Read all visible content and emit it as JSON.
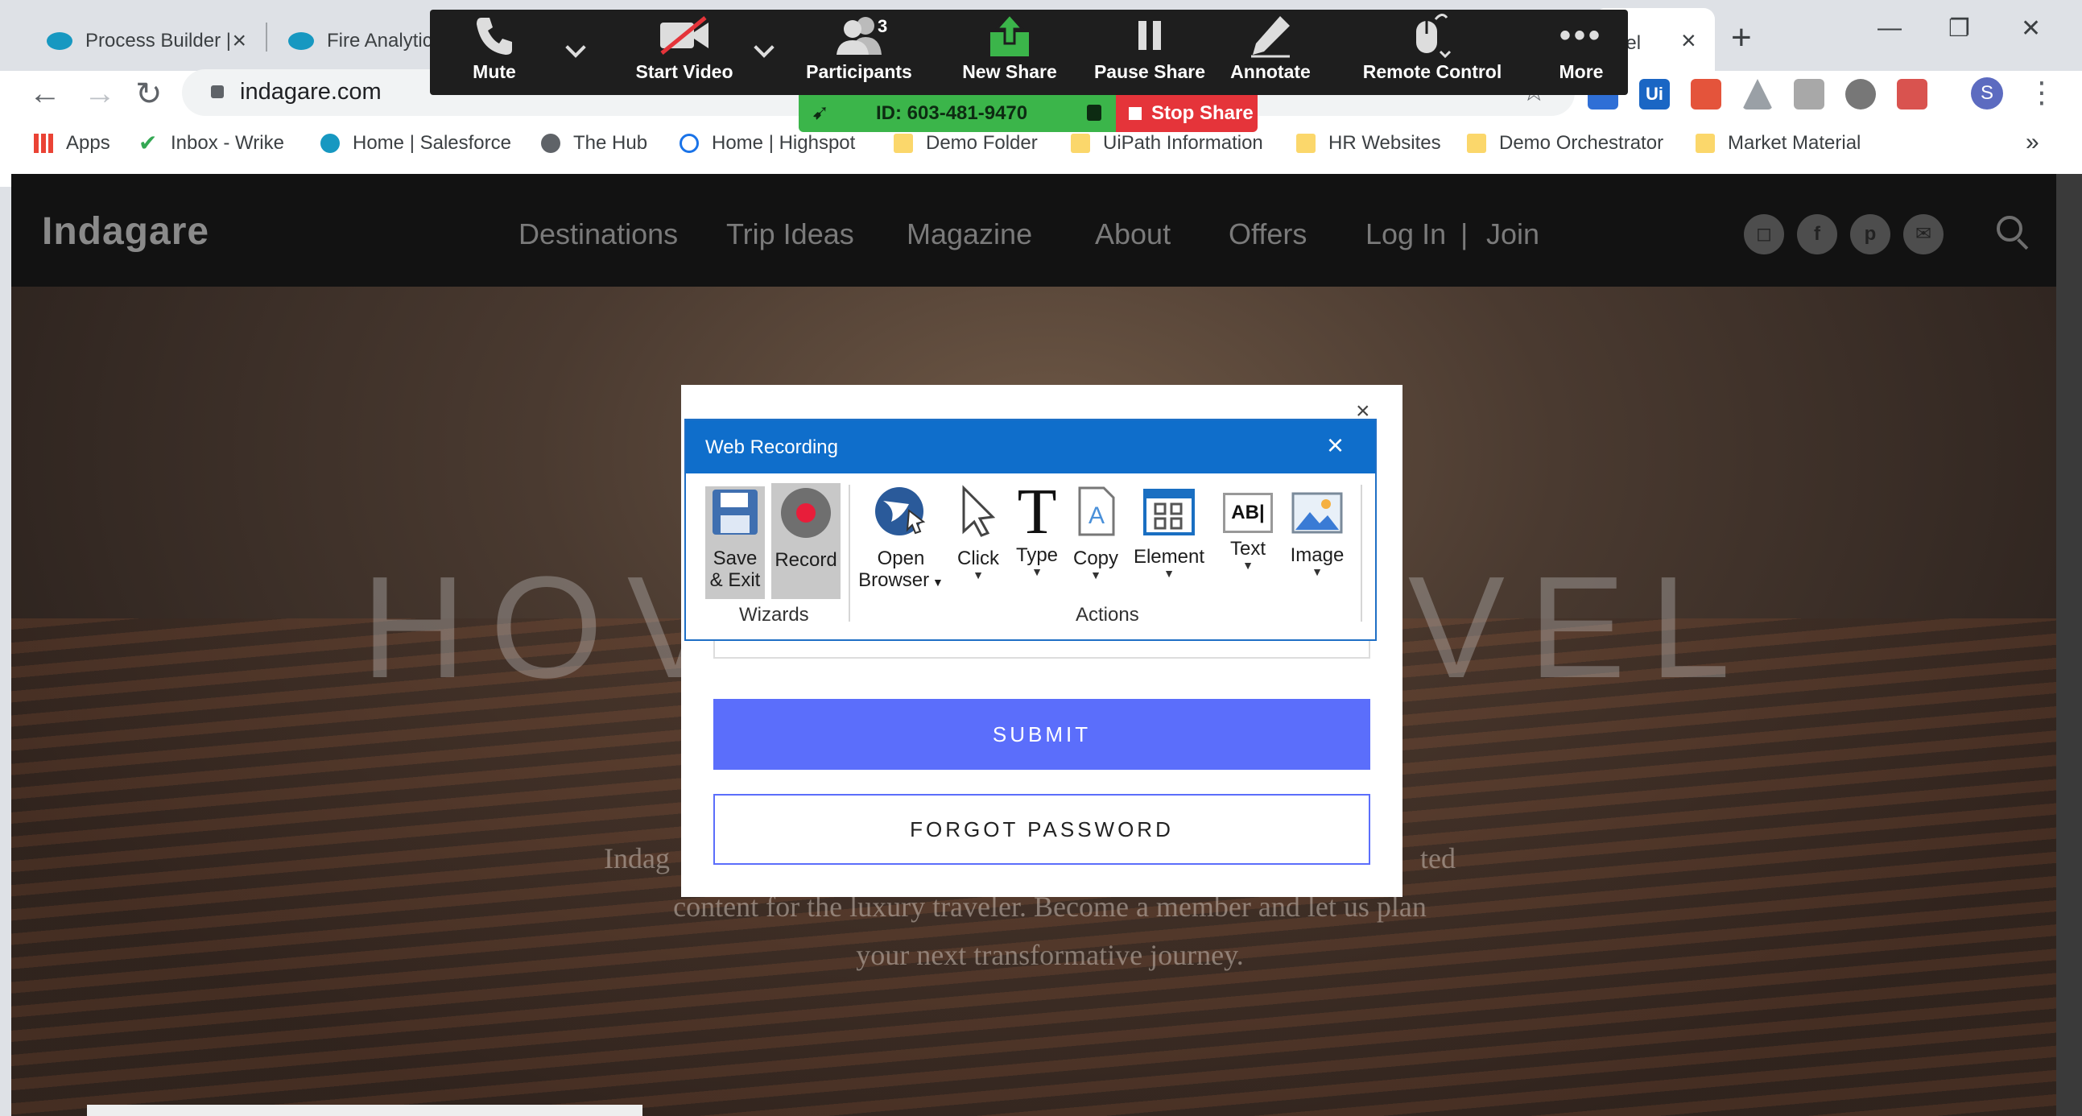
{
  "browser": {
    "tabs": [
      {
        "title": "Process Builder |"
      },
      {
        "title": "Fire Analytics"
      }
    ],
    "active_tab_fragment": "avel",
    "url": "indagare.com",
    "bookmarks": [
      {
        "label": "Apps"
      },
      {
        "label": "Inbox - Wrike"
      },
      {
        "label": "Home | Salesforce"
      },
      {
        "label": "The Hub"
      },
      {
        "label": "Home | Highspot"
      },
      {
        "label": "Demo Folder"
      },
      {
        "label": "UiPath Information"
      },
      {
        "label": "HR Websites"
      },
      {
        "label": "Demo Orchestrator"
      },
      {
        "label": "Market Material"
      }
    ],
    "avatar_letter": "S",
    "extension_label": "Ui"
  },
  "zoom": {
    "buttons": [
      {
        "label": "Mute",
        "icon": "phone-icon"
      },
      {
        "label": "Start Video",
        "icon": "video-off-icon"
      },
      {
        "label": "Participants",
        "icon": "participants-icon",
        "count": "3"
      },
      {
        "label": "New Share",
        "icon": "share-up-icon"
      },
      {
        "label": "Pause Share",
        "icon": "pause-icon"
      },
      {
        "label": "Annotate",
        "icon": "pen-icon"
      },
      {
        "label": "Remote Control",
        "icon": "mouse-icon"
      },
      {
        "label": "More",
        "icon": "more-dots-icon"
      }
    ],
    "meeting_id": "ID: 603-481-9470",
    "stop_share": "Stop Share",
    "colors": {
      "bar": "#1e1e1e",
      "id_bg": "#3bb54a",
      "stop_bg": "#e5343a"
    }
  },
  "site": {
    "brand": "Indagare",
    "nav": [
      "Destinations",
      "Trip Ideas",
      "Magazine",
      "About",
      "Offers",
      "Log In",
      "|",
      "Join"
    ],
    "social": [
      {
        "icon": "instagram-icon",
        "glyph": "◻"
      },
      {
        "icon": "facebook-icon",
        "glyph": "f"
      },
      {
        "icon": "pinterest-icon",
        "glyph": "p"
      },
      {
        "icon": "mail-icon",
        "glyph": "✉"
      }
    ],
    "hero_left": "HOV",
    "hero_right": "VEL",
    "hero_copy_1": "Indag",
    "hero_copy_1_end": "ted",
    "hero_copy_2": "content for the luxury traveler. Become a member and let us plan",
    "hero_copy_3": "your next transformative journey."
  },
  "login": {
    "password_mask": "• • • • • • •",
    "submit_label": "SUBMIT",
    "forgot_label": "FORGOT PASSWORD",
    "accent": "#5b6efb"
  },
  "recorder": {
    "title": "Web Recording",
    "wizards": [
      {
        "label_1": "Save",
        "label_2": "& Exit"
      },
      {
        "label_1": "Record"
      }
    ],
    "actions": [
      {
        "label_1": "Open",
        "label_2": "Browser"
      },
      {
        "label_1": "Click"
      },
      {
        "label_1": "Type"
      },
      {
        "label_1": "Copy"
      },
      {
        "label_1": "Element"
      },
      {
        "label_1": "Text"
      },
      {
        "label_1": "Image"
      }
    ],
    "group_wizards": "Wizards",
    "group_actions": "Actions",
    "accent": "#0f6ecb"
  }
}
